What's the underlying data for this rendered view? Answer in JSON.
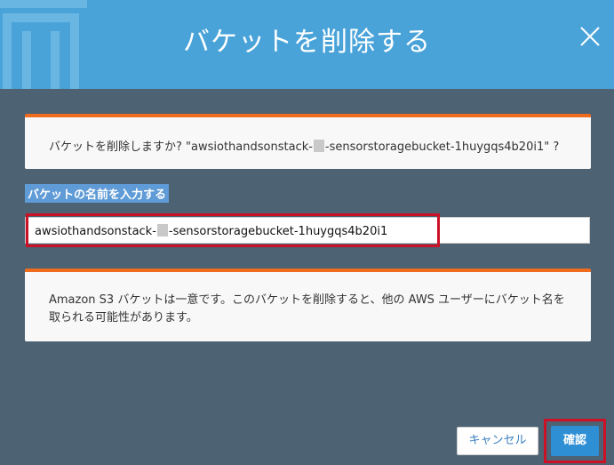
{
  "dialog": {
    "title": "バケットを削除する",
    "header_icon": "trash-icon",
    "close_icon": "close-icon"
  },
  "confirm_prompt": {
    "prefix": "バケットを削除しますか? \"awsiothandsonstack-",
    "suffix": "-sensorstoragebucket-1huygqs4b20i1\" ?"
  },
  "bucket_name_field": {
    "label": "バケットの名前を入力する",
    "value_prefix": "awsiothandsonstack-",
    "value_suffix": "-sensorstoragebucket-1huygqs4b20i1"
  },
  "notice": {
    "text": "Amazon S3 バケットは一意です。このバケットを削除すると、他の AWS ユーザーにバケット名を取られる可能性があります。"
  },
  "buttons": {
    "cancel_label": "キャンセル",
    "confirm_label": "確認"
  },
  "colors": {
    "header_bg": "#49a3d9",
    "overlay_bg": "#4d6272",
    "card_accent": "#ef6b1e",
    "highlight": "#cc1126",
    "primary_button": "#2f8fd5"
  }
}
